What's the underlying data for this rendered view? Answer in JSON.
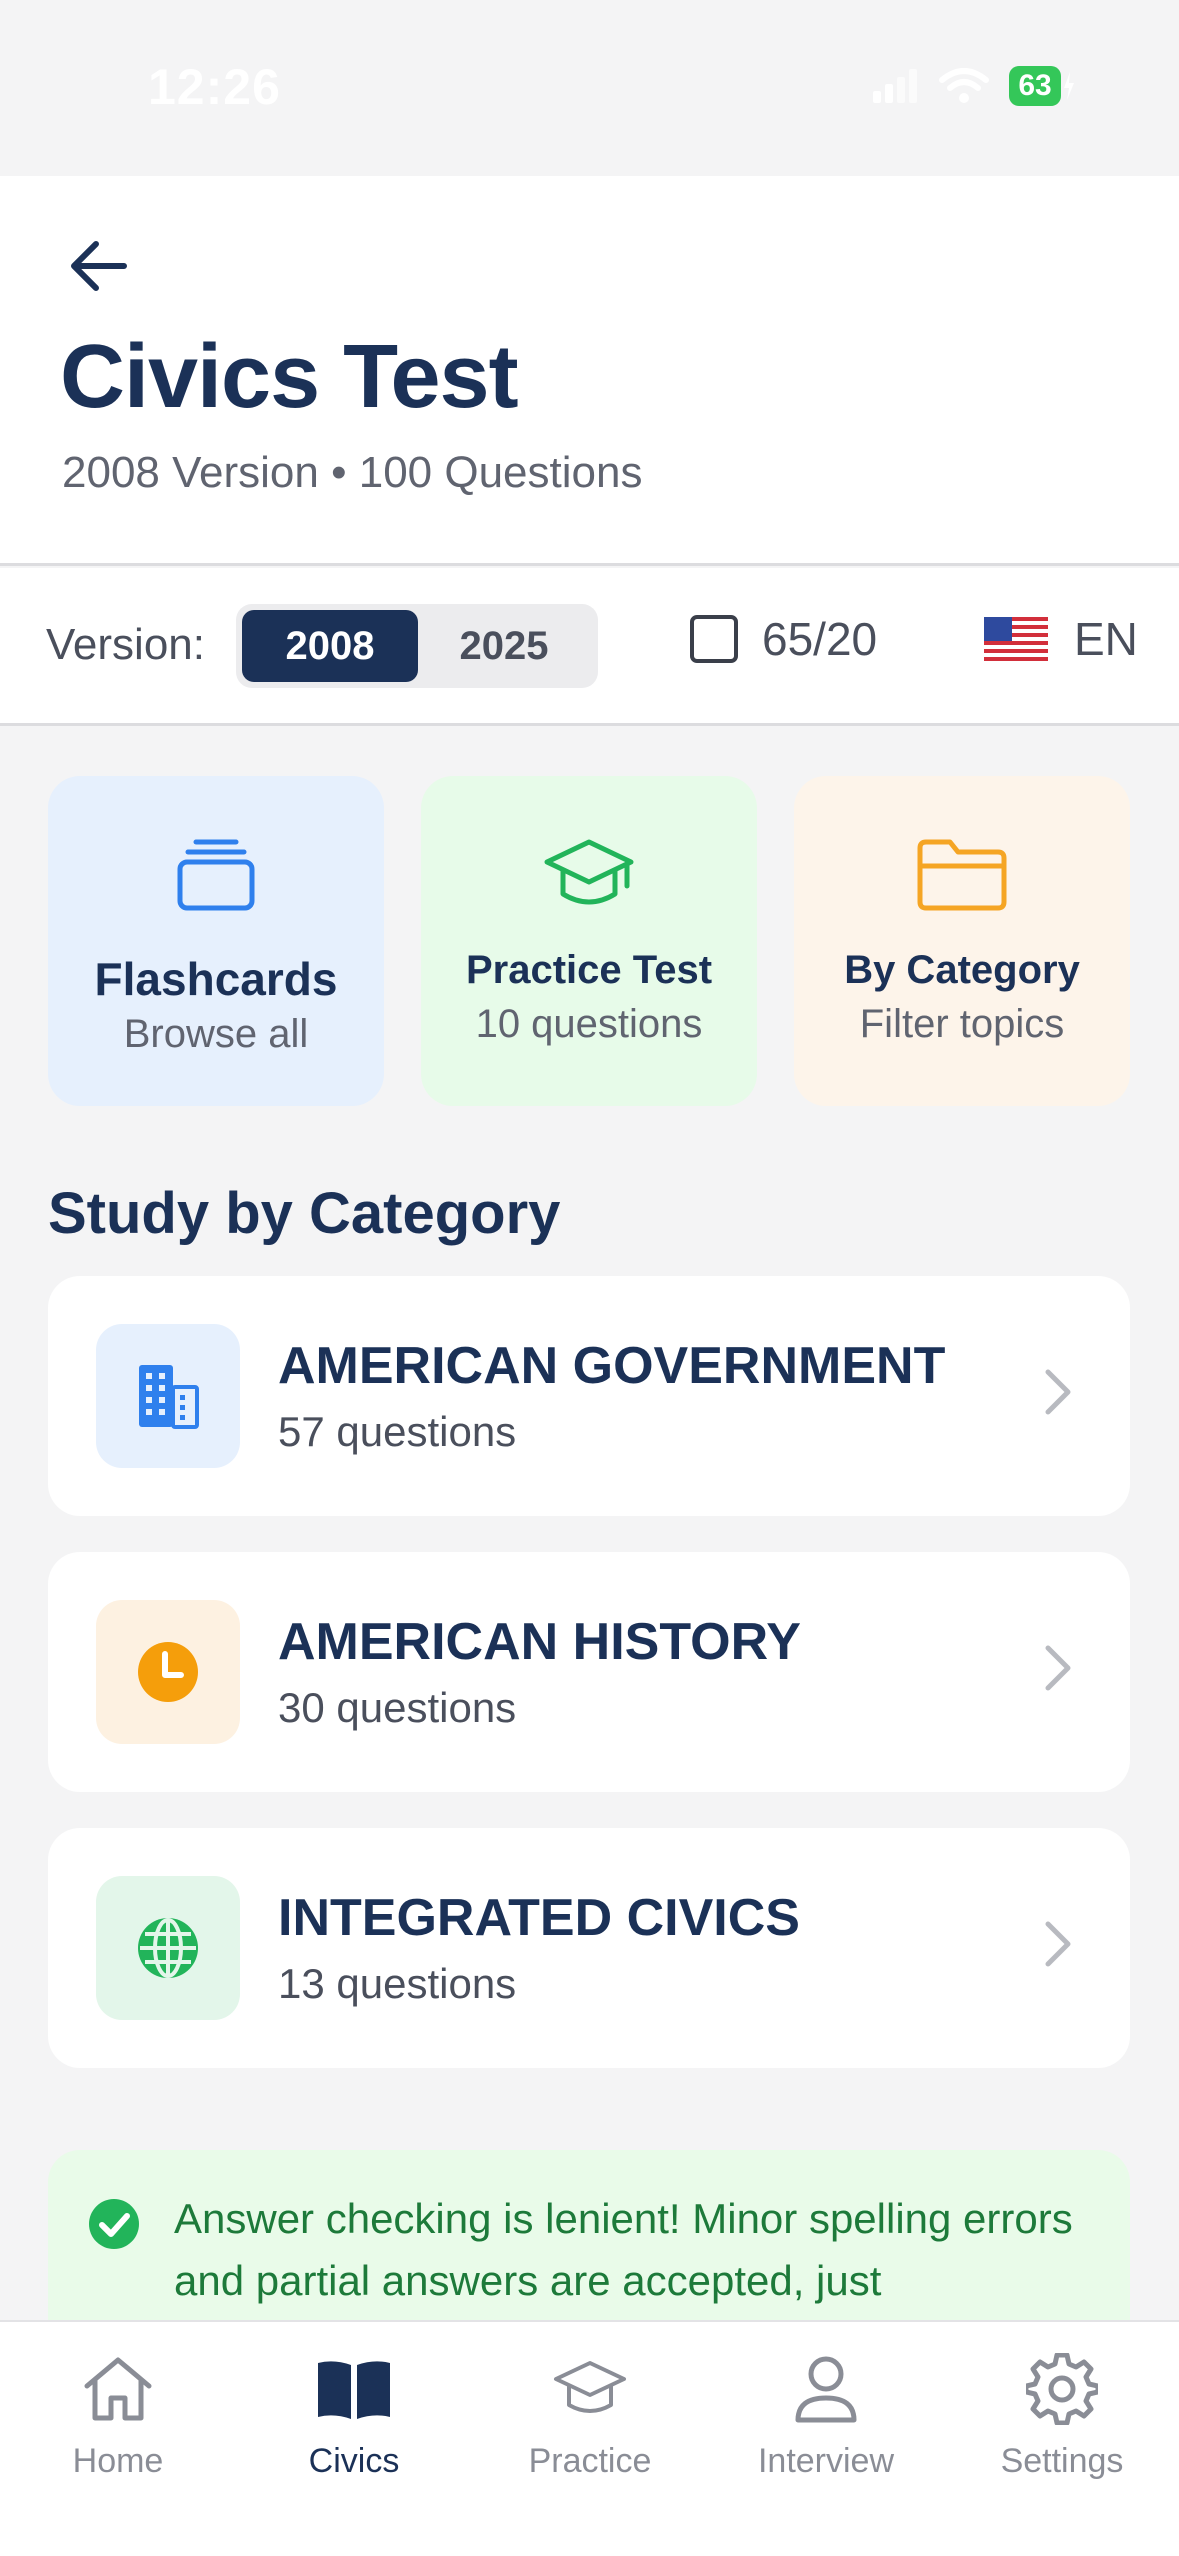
{
  "status_bar": {
    "time": "12:26",
    "battery": "63"
  },
  "header": {
    "title": "Civics Test",
    "subtitle": "2008 Version • 100 Questions"
  },
  "version_bar": {
    "label": "Version:",
    "options": [
      "2008",
      "2025"
    ],
    "selected": "2008",
    "rule_toggle_label": "65/20",
    "language": "EN"
  },
  "quick_actions": [
    {
      "title": "Flashcards",
      "subtitle": "Browse all",
      "icon": "cards-stack-icon",
      "bg": "#e6f0fd",
      "icon_color": "#2f80ed"
    },
    {
      "title": "Practice Test",
      "subtitle": "10 questions",
      "icon": "graduation-cap-icon",
      "bg": "#e7fbe9",
      "icon_color": "#22b45a"
    },
    {
      "title": "By Category",
      "subtitle": "Filter topics",
      "icon": "folder-icon",
      "bg": "#fdf4ea",
      "icon_color": "#f5a524"
    }
  ],
  "section_title": "Study by Category",
  "categories": [
    {
      "name": "AMERICAN GOVERNMENT",
      "count": "57 questions",
      "icon": "building-icon",
      "icon_bg": "#e6f0fd",
      "icon_color": "#2f80ed"
    },
    {
      "name": "AMERICAN HISTORY",
      "count": "30 questions",
      "icon": "clock-icon",
      "icon_bg": "#fdf1e1",
      "icon_color": "#f59e0b"
    },
    {
      "name": "INTEGRATED CIVICS",
      "count": "13 questions",
      "icon": "globe-icon",
      "icon_bg": "#e3f6ea",
      "icon_color": "#22b45a"
    }
  ],
  "info": {
    "text": "Answer checking is lenient! Minor spelling errors and partial answers are accepted, just"
  },
  "tabs": [
    {
      "label": "Home",
      "icon": "home-icon",
      "active": false
    },
    {
      "label": "Civics",
      "icon": "book-icon",
      "active": true
    },
    {
      "label": "Practice",
      "icon": "graduation-cap-icon",
      "active": false
    },
    {
      "label": "Interview",
      "icon": "person-icon",
      "active": false
    },
    {
      "label": "Settings",
      "icon": "gear-icon",
      "active": false
    }
  ]
}
